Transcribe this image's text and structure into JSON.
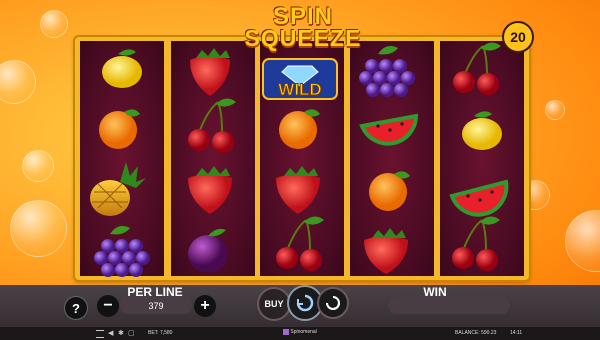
{
  "title": {
    "line1": "SPIN",
    "line2": "SQUEEZE",
    "amp": "&",
    "wild": "WILD"
  },
  "lines_count": "20",
  "reels": [
    [
      "lemon",
      "orange",
      "pineapple",
      "grapes"
    ],
    [
      "strawberry",
      "cherries",
      "strawberry",
      "plum"
    ],
    [
      "wild",
      "orange",
      "strawberry",
      "cherries"
    ],
    [
      "grapes",
      "watermelon",
      "orange",
      "strawberry"
    ],
    [
      "cherries",
      "lemon",
      "watermelon",
      "cherries"
    ]
  ],
  "controls": {
    "help": "?",
    "per_line_label": "PER LINE",
    "minus": "−",
    "per_line_value": "379",
    "plus": "+",
    "buy": "BUY",
    "win_label": "WIN",
    "win_value": ""
  },
  "status": {
    "bet": "BET: 7,580",
    "balance": "BALANCE: 590.23",
    "game": "Spinomenal",
    "time": "14:11"
  },
  "colors": {
    "accent": "#ffc21a",
    "reel_bg": "#4a0b22",
    "frame": "#f5b82a"
  }
}
